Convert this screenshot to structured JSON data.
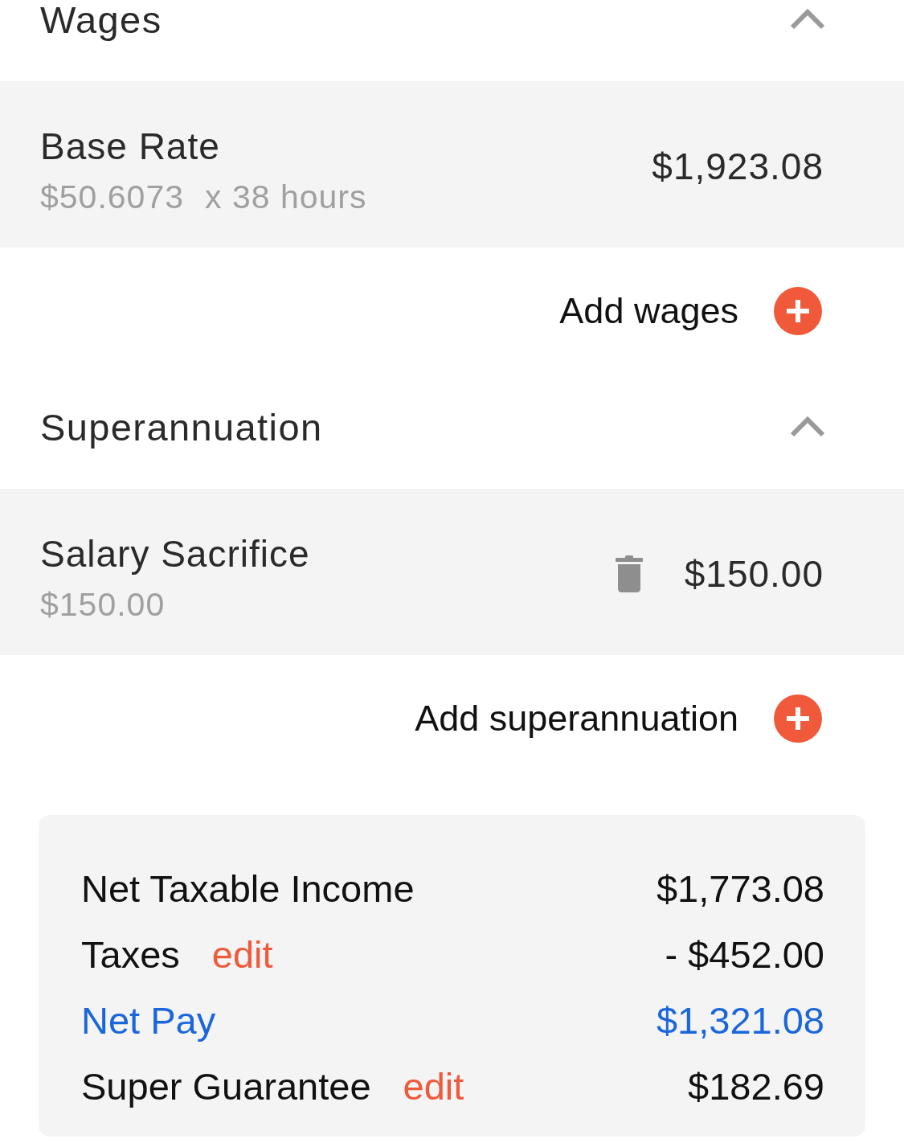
{
  "sections": [
    {
      "title": "Wages",
      "expanded": true,
      "items": [
        {
          "name": "Base Rate",
          "detail": [
            "$50.6073",
            "x 38 hours"
          ],
          "amount": "$1,923.08",
          "deletable": false
        }
      ],
      "add_label": "Add wages"
    },
    {
      "title": "Superannuation",
      "expanded": true,
      "items": [
        {
          "name": "Salary Sacrifice",
          "detail": [
            "$150.00"
          ],
          "amount": "$150.00",
          "deletable": true
        }
      ],
      "add_label": "Add superannuation"
    }
  ],
  "summary": [
    {
      "label": "Net Taxable Income",
      "value": "$1,773.08",
      "highlighted": false
    },
    {
      "label": "Taxes",
      "action": "edit",
      "value": "- $452.00",
      "highlighted": false
    },
    {
      "label": "Net Pay",
      "value": "$1,321.08",
      "highlighted": true
    },
    {
      "label": "Super Guarantee",
      "action": "edit",
      "value": "$182.69",
      "highlighted": false
    }
  ]
}
